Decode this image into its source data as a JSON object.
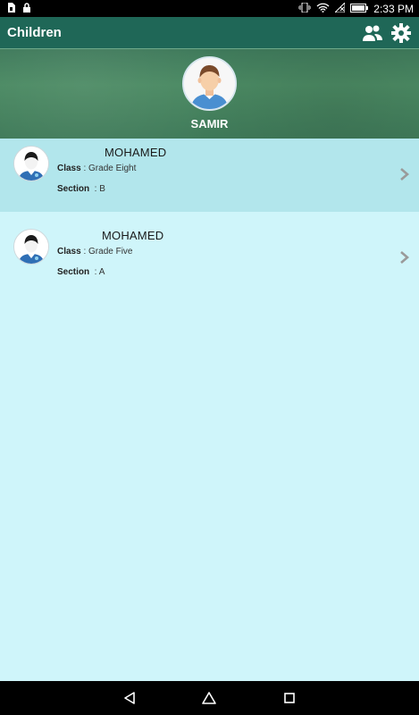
{
  "status_bar": {
    "time": "2:33 PM",
    "left_icons": [
      "sim-card-icon",
      "lock-icon"
    ],
    "right_icons": [
      "vibrate-icon",
      "wifi-icon",
      "no-signal-icon",
      "battery-icon"
    ]
  },
  "app_bar": {
    "title": "Children",
    "actions": [
      "parents-icon",
      "settings-icon"
    ]
  },
  "header": {
    "parent_name": "SAMIR"
  },
  "children": [
    {
      "name": "MOHAMED",
      "class_label": "Class",
      "class_value": "Grade Eight",
      "section_label": "Section",
      "section_value": "B",
      "selected": true
    },
    {
      "name": "MOHAMED",
      "class_label": "Class",
      "class_value": "Grade Five",
      "section_label": "Section",
      "section_value": "A",
      "selected": false
    }
  ],
  "nav_bar": {
    "buttons": [
      "back-icon",
      "home-icon",
      "recents-icon"
    ]
  },
  "colors": {
    "app_bar": "#1f6757",
    "list_background": "#cff5fa",
    "selected_row": "#b2e6ec"
  }
}
